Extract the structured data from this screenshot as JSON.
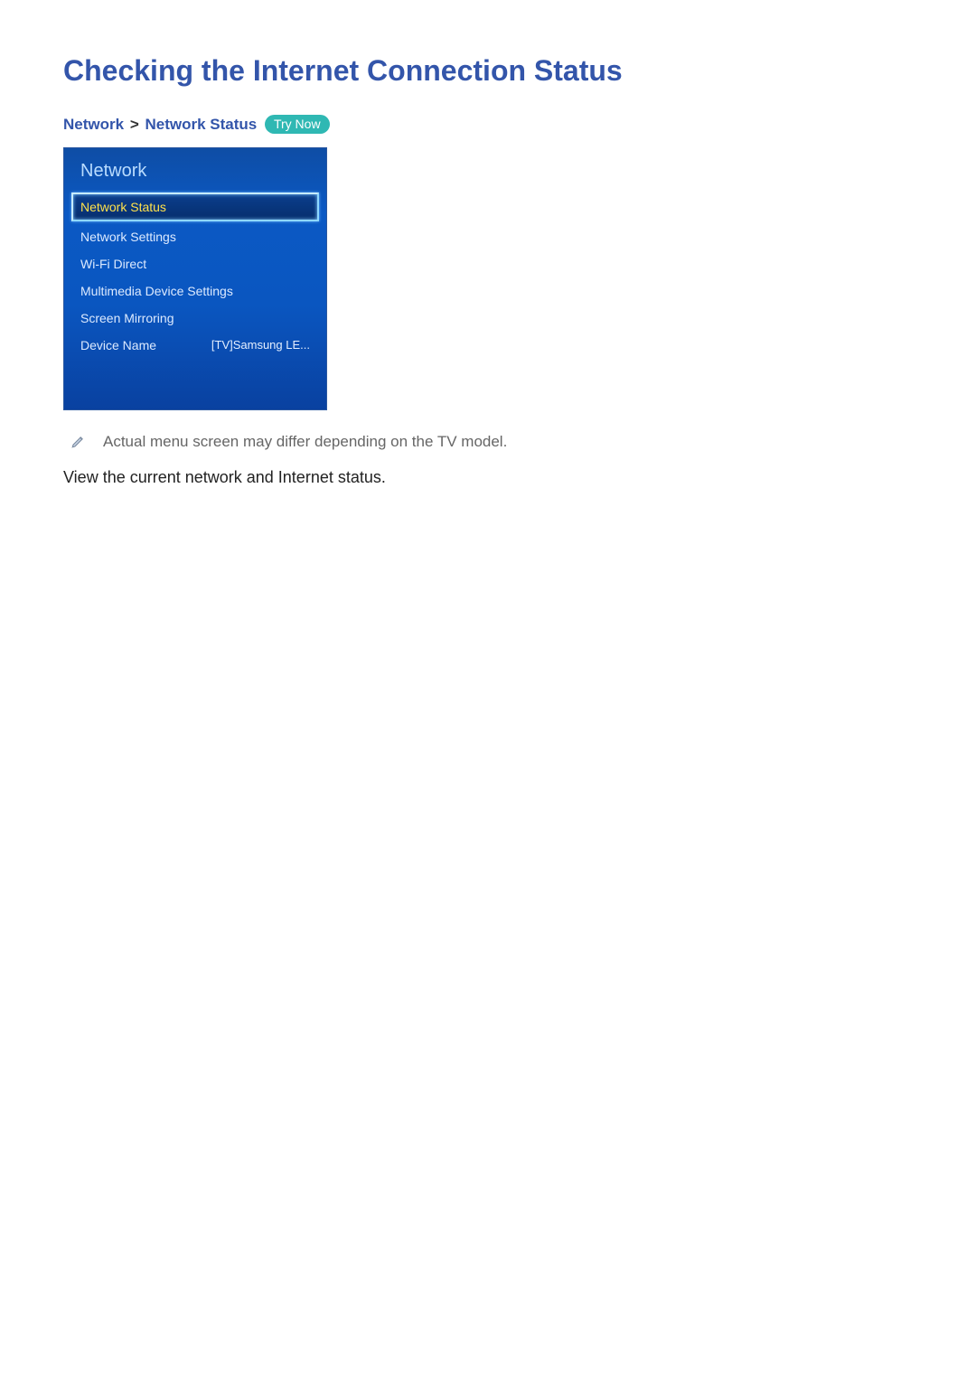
{
  "title": "Checking the Internet Connection Status",
  "breadcrumb": {
    "part1": "Network",
    "sep": ">",
    "part2": "Network Status",
    "try_now": "Try Now"
  },
  "menu": {
    "header": "Network",
    "items": [
      {
        "label": "Network Status",
        "value": "",
        "selected": true
      },
      {
        "label": "Network Settings",
        "value": "",
        "selected": false
      },
      {
        "label": "Wi-Fi Direct",
        "value": "",
        "selected": false
      },
      {
        "label": "Multimedia Device Settings",
        "value": "",
        "selected": false
      },
      {
        "label": "Screen Mirroring",
        "value": "",
        "selected": false
      },
      {
        "label": "Device Name",
        "value": "[TV]Samsung LE...",
        "selected": false
      }
    ]
  },
  "note": "Actual menu screen may differ depending on the TV model.",
  "description": "View the current network and Internet status."
}
